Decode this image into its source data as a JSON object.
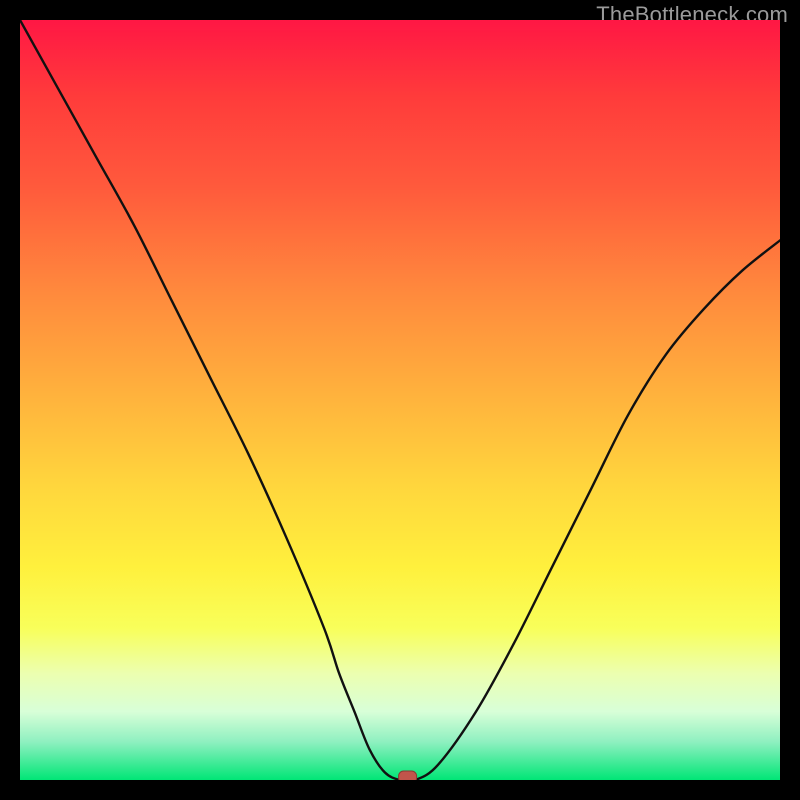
{
  "watermark": "TheBottleneck.com",
  "chart_data": {
    "type": "line",
    "title": "",
    "xlabel": "",
    "ylabel": "",
    "xlim": [
      0,
      100
    ],
    "ylim": [
      0,
      100
    ],
    "grid": false,
    "x": [
      0,
      5,
      10,
      15,
      20,
      25,
      30,
      35,
      40,
      42,
      44,
      46,
      48,
      50,
      52,
      55,
      60,
      65,
      70,
      75,
      80,
      85,
      90,
      95,
      100
    ],
    "y": [
      100,
      91,
      82,
      73,
      63,
      53,
      43,
      32,
      20,
      14,
      9,
      4,
      1,
      0,
      0,
      2,
      9,
      18,
      28,
      38,
      48,
      56,
      62,
      67,
      71
    ],
    "series": [
      {
        "name": "bottleneck-curve",
        "type": "line"
      }
    ],
    "marker": {
      "x": 51,
      "y": 0,
      "color": "#c1554b"
    },
    "background_gradient": {
      "direction": "vertical",
      "stops": [
        {
          "pos": 0,
          "color": "#ff1744"
        },
        {
          "pos": 50,
          "color": "#ffb43d"
        },
        {
          "pos": 80,
          "color": "#f8ff5a"
        },
        {
          "pos": 100,
          "color": "#00e676"
        }
      ]
    }
  }
}
